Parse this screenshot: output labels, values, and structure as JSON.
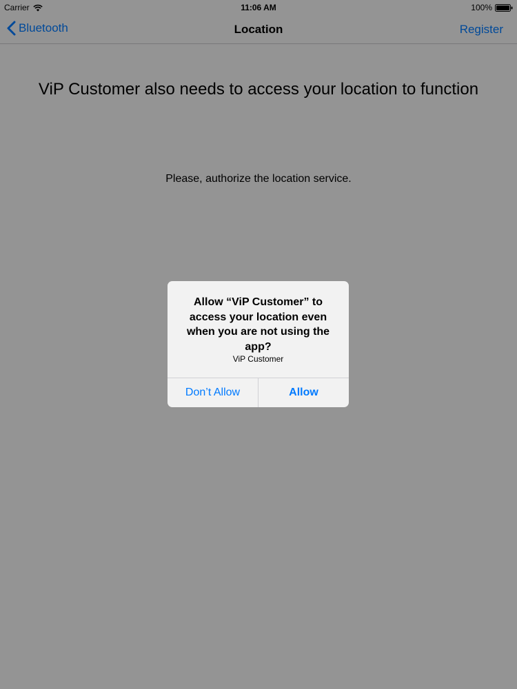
{
  "status_bar": {
    "carrier": "Carrier",
    "wifi_icon": "wifi-icon",
    "time": "11:06 AM",
    "battery_percent": "100%",
    "battery_icon": "battery-icon",
    "battery_level": 1.0
  },
  "nav_bar": {
    "back_label": "Bluetooth",
    "back_icon": "chevron-left-icon",
    "title": "Location",
    "right_label": "Register",
    "accent_color": "#007aff"
  },
  "content": {
    "heading": "ViP Customer also needs to access your location to function",
    "subtext": "Please, authorize the location service."
  },
  "alert": {
    "title": "Allow “ViP Customer” to access your location even when you are not using the app?",
    "message": "ViP Customer",
    "buttons": [
      {
        "label": "Don’t Allow"
      },
      {
        "label": "Allow"
      }
    ]
  }
}
